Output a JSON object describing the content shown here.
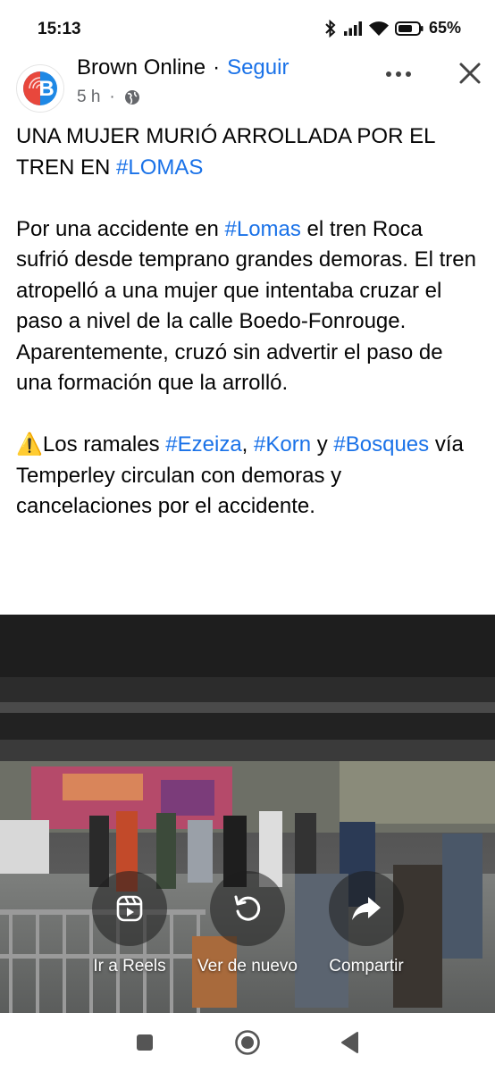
{
  "status_bar": {
    "time": "15:13",
    "battery_percent": "65%",
    "icons": [
      "bluetooth-icon",
      "signal-icon",
      "wifi-icon",
      "battery-icon"
    ]
  },
  "post": {
    "author": "Brown Online",
    "separator": "·",
    "follow_label": "Seguir",
    "time_ago": "5 h",
    "meta_separator": "·",
    "privacy_icon": "globe-icon",
    "avatar_letter": "B",
    "title": {
      "text": "UNA MUJER MURIÓ ARROLLADA POR EL TREN EN ",
      "hashtag": "#LOMAS"
    },
    "paragraph1": {
      "before": "Por una accidente en ",
      "hashtag": "#Lomas",
      "after": " el tren Roca sufrió desde temprano grandes demoras. El tren atropelló a una mujer que intentaba cruzar el paso a nivel de la calle Boedo-Fonrouge. Aparentemente, cruzó sin advertir el paso de una formación que la arrolló."
    },
    "paragraph2": {
      "warning_emoji": "⚠️",
      "text1": "Los ramales ",
      "hashtag1": "#Ezeiza",
      "comma": ", ",
      "hashtag2": "#Korn",
      "text2": " y ",
      "hashtag3": "#Bosques",
      "text3": " vía Temperley circulan con demoras y cancelaciones por el accidente."
    }
  },
  "video": {
    "actions": [
      {
        "label": "Ir a Reels",
        "icon": "reels-icon"
      },
      {
        "label": "Ver de nuevo",
        "icon": "replay-icon"
      },
      {
        "label": "Compartir",
        "icon": "share-icon"
      }
    ]
  },
  "nav_bar": {
    "buttons": [
      "recents-square-icon",
      "home-circle-icon",
      "back-triangle-icon"
    ]
  },
  "colors": {
    "link": "#1a72e8",
    "text": "#050505",
    "meta": "#65676b",
    "brand_red": "#e8473c",
    "brand_blue": "#1e88e5"
  }
}
